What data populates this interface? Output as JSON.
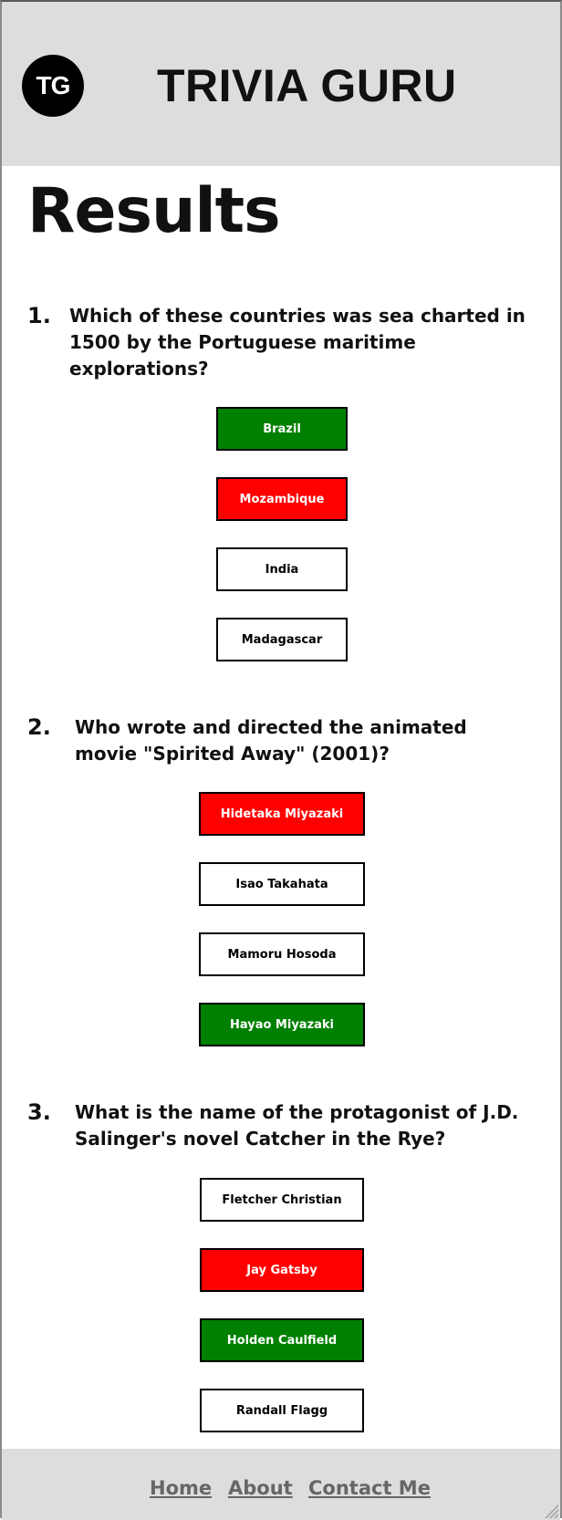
{
  "header": {
    "logo_text": "TG",
    "site_title": "TRIVIA GURU"
  },
  "page_title": "Results",
  "questions": [
    {
      "number": "1.",
      "text": "Which of these countries was sea charted in 1500 by the Portuguese maritime explorations?",
      "answers": [
        {
          "label": "Brazil",
          "status": "correct"
        },
        {
          "label": "Mozambique",
          "status": "wrong"
        },
        {
          "label": "India",
          "status": "neutral"
        },
        {
          "label": "Madagascar",
          "status": "neutral"
        }
      ]
    },
    {
      "number": "2.",
      "text": "Who wrote and directed the animated movie \"Spirited Away\" (2001)?",
      "answers": [
        {
          "label": "Hidetaka Miyazaki",
          "status": "wrong"
        },
        {
          "label": "Isao Takahata",
          "status": "neutral"
        },
        {
          "label": "Mamoru Hosoda",
          "status": "neutral"
        },
        {
          "label": "Hayao Miyazaki",
          "status": "correct"
        }
      ]
    },
    {
      "number": "3.",
      "text": "What is the name of the protagonist of J.D. Salinger's novel Catcher in the Rye?",
      "answers": [
        {
          "label": "Fletcher Christian",
          "status": "neutral"
        },
        {
          "label": "Jay Gatsby",
          "status": "wrong"
        },
        {
          "label": "Holden Caulfield",
          "status": "correct"
        },
        {
          "label": "Randall Flagg",
          "status": "neutral"
        }
      ]
    }
  ],
  "footer": {
    "links": [
      "Home",
      "About",
      "Contact Me"
    ]
  },
  "colors": {
    "correct": "#008000",
    "wrong": "#ff0000",
    "header_bg": "#dddddd"
  }
}
